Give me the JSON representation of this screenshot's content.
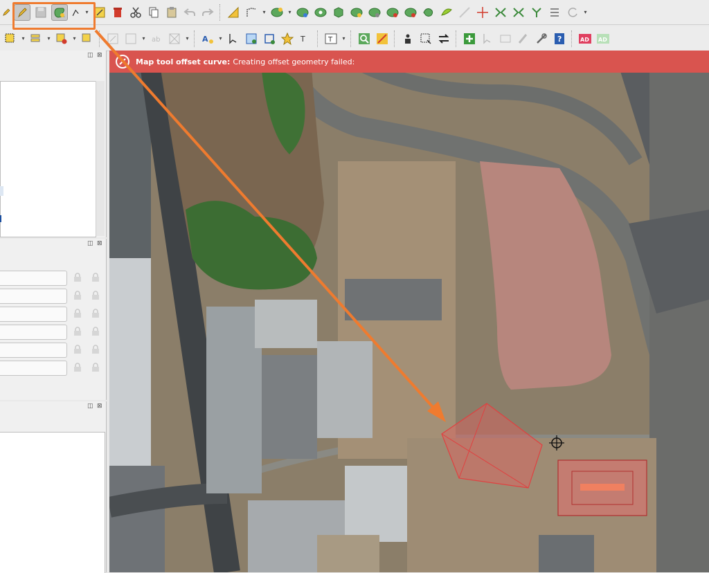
{
  "message_bar": {
    "title": "Map tool offset curve:",
    "text": "Creating offset geometry failed:"
  },
  "toolbar2": {
    "ad_label": "AD",
    "ad2_label": "AD"
  },
  "colors": {
    "message_bar": "#d9544f",
    "annotation_orange": "#ef7b2f",
    "failed_geometry": "#e06060"
  },
  "icons": {
    "toolbar1": [
      "edit-pencil-icon",
      "save-edits-icon",
      "offset-curve-icon",
      "digitize-icon",
      "node-tool-icon",
      "delete-icon",
      "cut-icon",
      "copy-icon",
      "paste-icon",
      "undo-icon",
      "redo-icon",
      "measure-icon",
      "simplify-icon",
      "add-ring-icon",
      "add-part-icon",
      "fill-ring-icon",
      "delete-ring-icon",
      "delete-part-icon",
      "reshape-icon",
      "split-icon",
      "merge-icon",
      "rotate-icon"
    ],
    "toolbar2": [
      "select-icon",
      "deselect-icon",
      "label-icon",
      "pin-icon",
      "text-annotation-icon",
      "identify-icon",
      "processing-icon",
      "plugins-icon",
      "help-icon"
    ]
  }
}
